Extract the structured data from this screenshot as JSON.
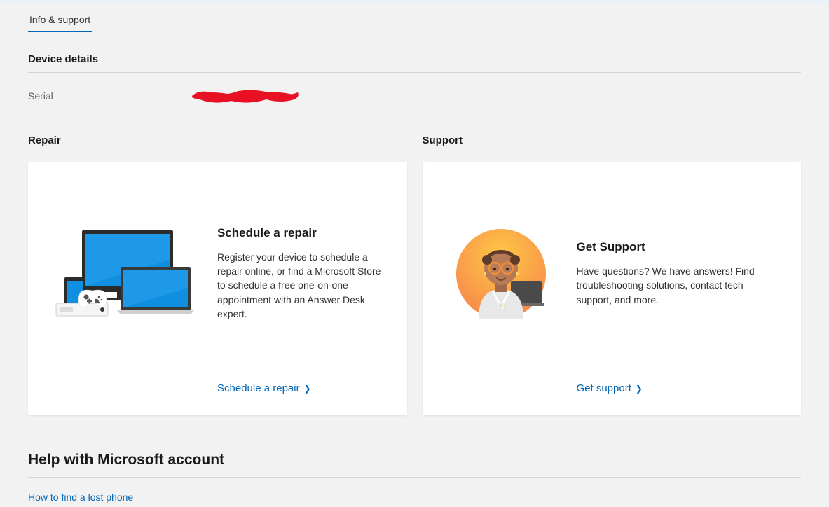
{
  "tab": {
    "label": "Info & support"
  },
  "device_details": {
    "heading": "Device details",
    "serial_label": "Serial"
  },
  "repair": {
    "heading": "Repair",
    "card_title": "Schedule a repair",
    "card_desc": "Register your device to schedule a repair online, or find a Microsoft Store to schedule a free one-on-one appointment with an Answer Desk expert.",
    "link_label": "Schedule a repair"
  },
  "support": {
    "heading": "Support",
    "card_title": "Get Support",
    "card_desc": "Have questions? We have answers! Find troubleshooting solutions, contact tech support, and more.",
    "link_label": "Get support"
  },
  "help": {
    "heading": "Help with Microsoft account",
    "link_lost_phone": "How to find a lost phone"
  },
  "colors": {
    "accent": "#0067b8"
  }
}
